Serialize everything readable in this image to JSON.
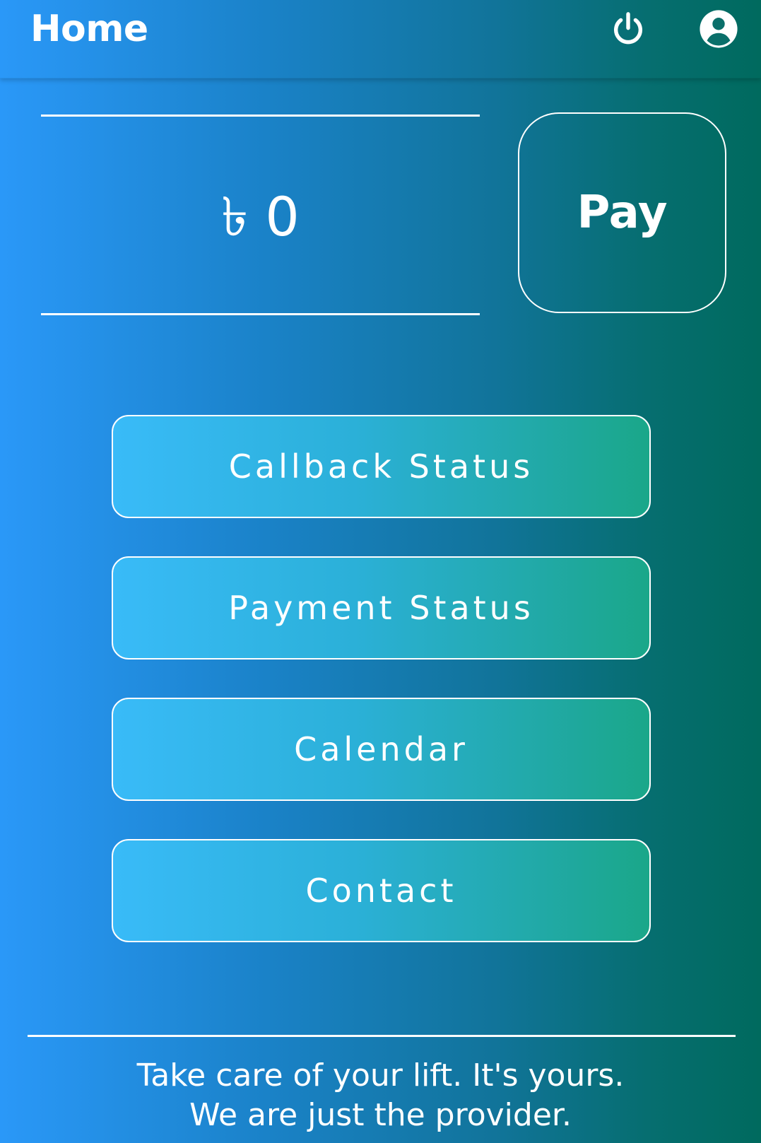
{
  "appbar": {
    "title": "Home",
    "icons": [
      "power-icon",
      "account-circle-icon"
    ]
  },
  "balance": {
    "amount": "৳ 0"
  },
  "pay_button": {
    "label": "Pay"
  },
  "menu": [
    {
      "label": "Callback Status"
    },
    {
      "label": "Payment Status"
    },
    {
      "label": "Calendar"
    },
    {
      "label": "Contact"
    }
  ],
  "footer": {
    "line1": "Take care of your lift. It's yours.",
    "line2": "We are just the provider."
  },
  "colors": {
    "gradient_start": "#2a98f8",
    "gradient_end": "#006a5e",
    "button_start": "#39bbf8",
    "button_end": "#1aa789",
    "foreground": "#ffffff"
  }
}
